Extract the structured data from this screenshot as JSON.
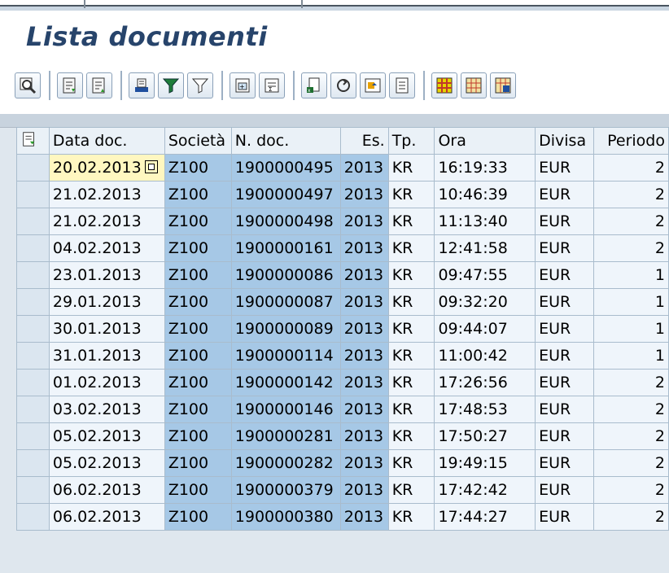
{
  "title": "Lista documenti",
  "toolbar": {
    "icons": [
      "details-icon",
      "sort-ascending-icon",
      "sort-descending-icon",
      "find-icon",
      "filter-icon",
      "filter-off-icon",
      "subtotal-icon",
      "total-icon",
      "export-icon",
      "print-icon",
      "view-icon",
      "layout-icon",
      "layout-select-icon",
      "layout-save-icon",
      "layout-manage-icon"
    ]
  },
  "columns": [
    "Data doc.",
    "Società",
    "N. doc.",
    "Es.",
    "Tp.",
    "Ora",
    "Divisa",
    "Periodo"
  ],
  "rows": [
    {
      "date": "20.02.2013",
      "company": "Z100",
      "doc": "1900000495",
      "year": "2013",
      "type": "KR",
      "time": "16:19:33",
      "currency": "EUR",
      "period": "2"
    },
    {
      "date": "21.02.2013",
      "company": "Z100",
      "doc": "1900000497",
      "year": "2013",
      "type": "KR",
      "time": "10:46:39",
      "currency": "EUR",
      "period": "2"
    },
    {
      "date": "21.02.2013",
      "company": "Z100",
      "doc": "1900000498",
      "year": "2013",
      "type": "KR",
      "time": "11:13:40",
      "currency": "EUR",
      "period": "2"
    },
    {
      "date": "04.02.2013",
      "company": "Z100",
      "doc": "1900000161",
      "year": "2013",
      "type": "KR",
      "time": "12:41:58",
      "currency": "EUR",
      "period": "2"
    },
    {
      "date": "23.01.2013",
      "company": "Z100",
      "doc": "1900000086",
      "year": "2013",
      "type": "KR",
      "time": "09:47:55",
      "currency": "EUR",
      "period": "1"
    },
    {
      "date": "29.01.2013",
      "company": "Z100",
      "doc": "1900000087",
      "year": "2013",
      "type": "KR",
      "time": "09:32:20",
      "currency": "EUR",
      "period": "1"
    },
    {
      "date": "30.01.2013",
      "company": "Z100",
      "doc": "1900000089",
      "year": "2013",
      "type": "KR",
      "time": "09:44:07",
      "currency": "EUR",
      "period": "1"
    },
    {
      "date": "31.01.2013",
      "company": "Z100",
      "doc": "1900000114",
      "year": "2013",
      "type": "KR",
      "time": "11:00:42",
      "currency": "EUR",
      "period": "1"
    },
    {
      "date": "01.02.2013",
      "company": "Z100",
      "doc": "1900000142",
      "year": "2013",
      "type": "KR",
      "time": "17:26:56",
      "currency": "EUR",
      "period": "2"
    },
    {
      "date": "03.02.2013",
      "company": "Z100",
      "doc": "1900000146",
      "year": "2013",
      "type": "KR",
      "time": "17:48:53",
      "currency": "EUR",
      "period": "2"
    },
    {
      "date": "05.02.2013",
      "company": "Z100",
      "doc": "1900000281",
      "year": "2013",
      "type": "KR",
      "time": "17:50:27",
      "currency": "EUR",
      "period": "2"
    },
    {
      "date": "05.02.2013",
      "company": "Z100",
      "doc": "1900000282",
      "year": "2013",
      "type": "KR",
      "time": "19:49:15",
      "currency": "EUR",
      "period": "2"
    },
    {
      "date": "06.02.2013",
      "company": "Z100",
      "doc": "1900000379",
      "year": "2013",
      "type": "KR",
      "time": "17:42:42",
      "currency": "EUR",
      "period": "2"
    },
    {
      "date": "06.02.2013",
      "company": "Z100",
      "doc": "1900000380",
      "year": "2013",
      "type": "KR",
      "time": "17:44:27",
      "currency": "EUR",
      "period": "2"
    }
  ]
}
